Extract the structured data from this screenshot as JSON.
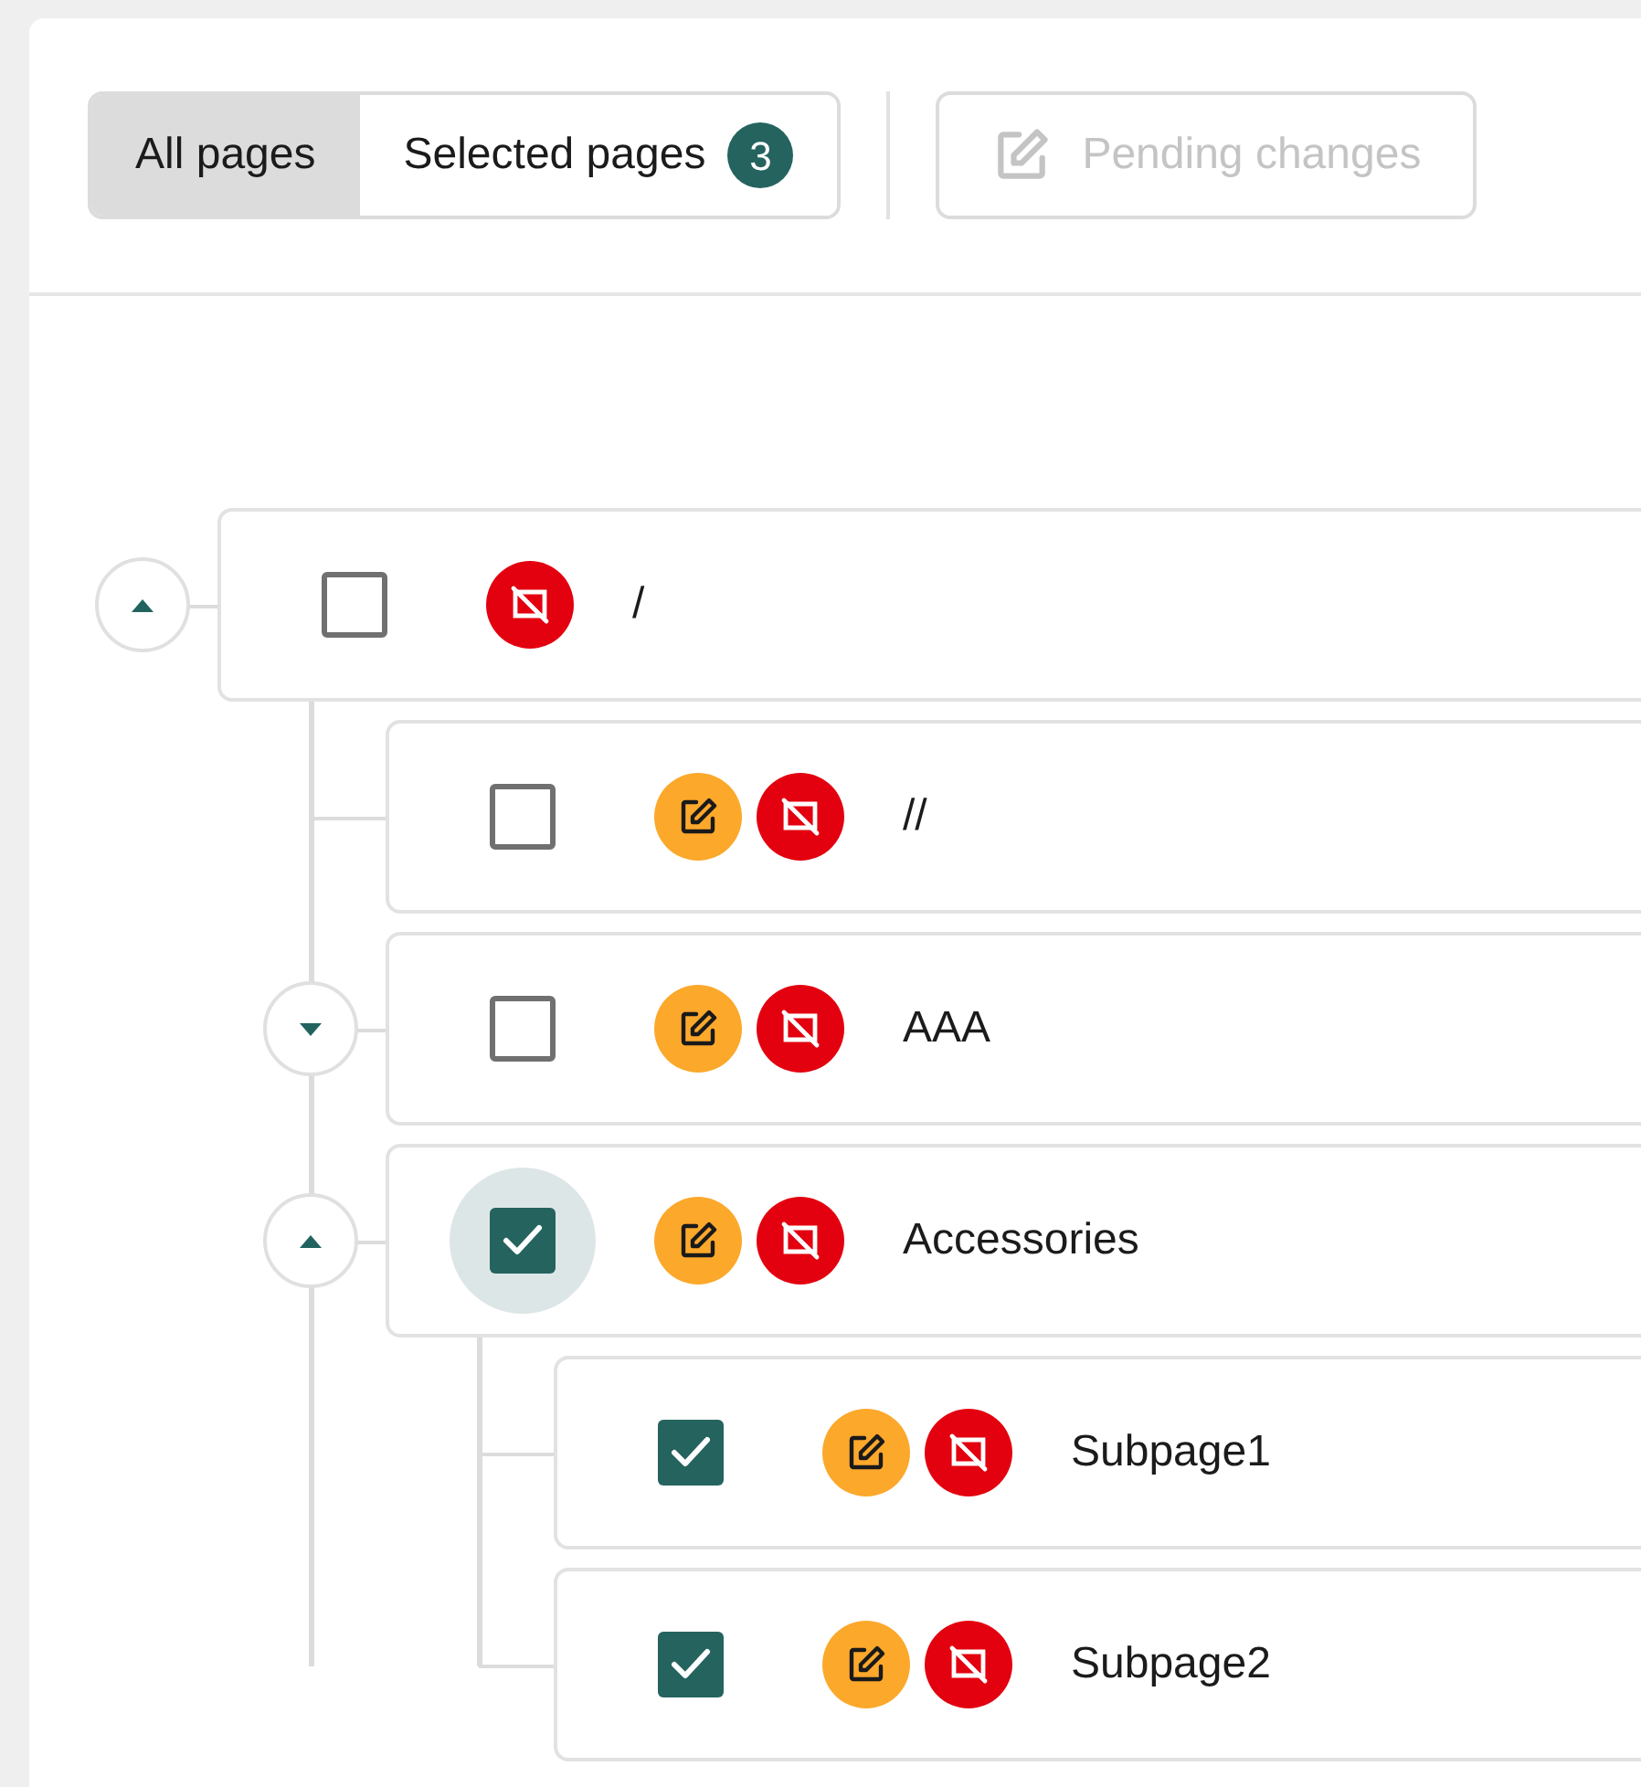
{
  "view_tabs": [
    {
      "label": "All pages",
      "selected": true
    },
    {
      "label": "Selected pages",
      "selected": false,
      "count": "3"
    }
  ],
  "pending_button": {
    "label": "Pending changes",
    "disabled": true
  },
  "tree": [
    {
      "title": "/",
      "checked": false,
      "focused": false,
      "expanded": true,
      "statuses": [
        {
          "kind": "offline"
        }
      ],
      "children": [
        {
          "title": "//",
          "checked": false,
          "focused": false,
          "statuses": [
            {
              "kind": "edited"
            },
            {
              "kind": "offline"
            }
          ]
        },
        {
          "title": "AAA",
          "checked": false,
          "focused": false,
          "expanded": false,
          "statuses": [
            {
              "kind": "edited"
            },
            {
              "kind": "offline"
            }
          ]
        },
        {
          "title": "Accessories",
          "checked": true,
          "focused": true,
          "expanded": true,
          "statuses": [
            {
              "kind": "edited"
            },
            {
              "kind": "offline"
            }
          ],
          "children": [
            {
              "title": "Subpage1",
              "checked": true,
              "focused": false,
              "statuses": [
                {
                  "kind": "edited"
                },
                {
                  "kind": "offline"
                }
              ]
            },
            {
              "title": "Subpage2",
              "checked": true,
              "focused": false,
              "statuses": [
                {
                  "kind": "edited"
                },
                {
                  "kind": "offline"
                }
              ]
            }
          ]
        }
      ]
    }
  ]
}
